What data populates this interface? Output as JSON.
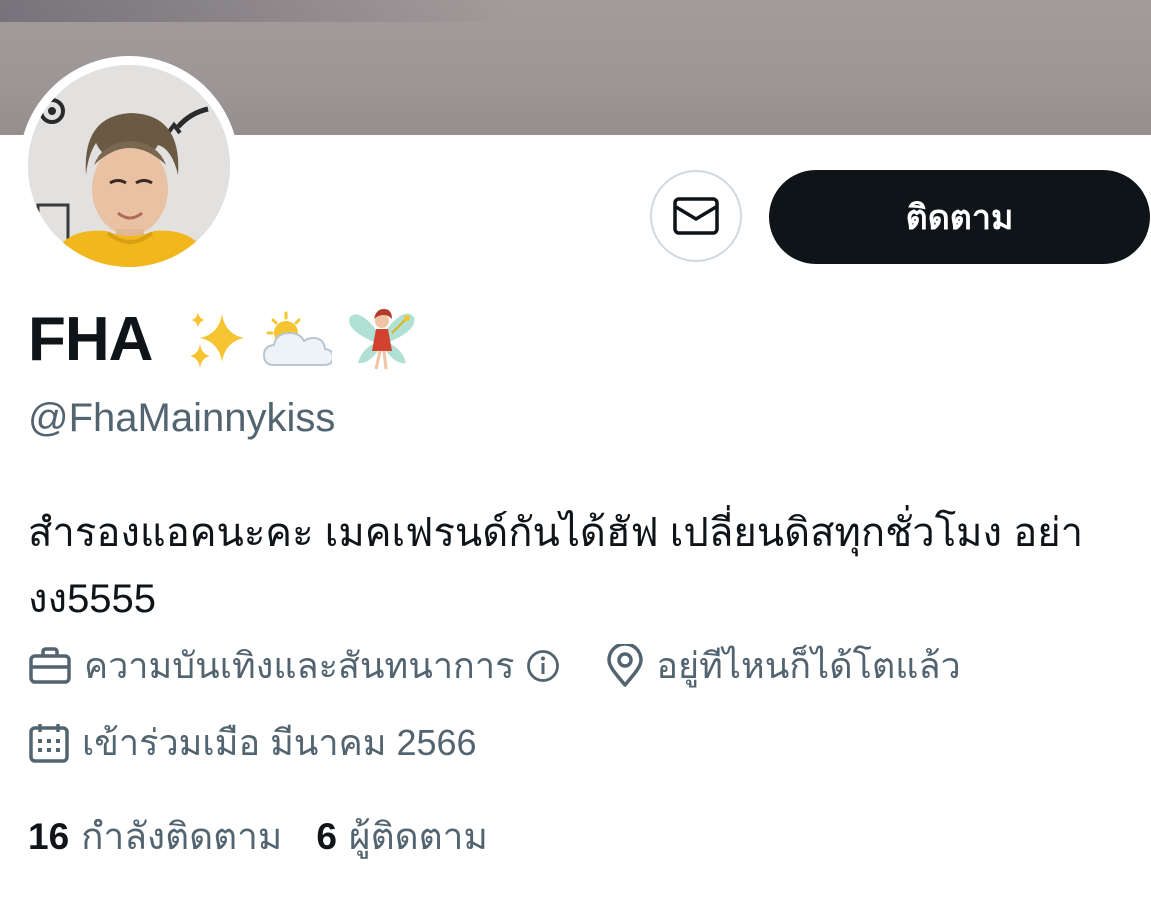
{
  "profile": {
    "display_name": "FHA",
    "name_emojis": [
      "sparkles-emoji",
      "sun-behind-cloud-emoji",
      "fairy-emoji"
    ],
    "handle": "@FhaMainnykiss",
    "bio": "สำรองแอคนะคะ เมคเฟรนด์กันได้ฮัฟ เปลี่ยนดิสทุกชั่วโมง อย่า งง5555",
    "category": "ความบันเทิงและสันทนาการ",
    "location": "อยู่ทีไหนก็ได้โตแล้ว",
    "joined": "เข้าร่วมเมือ มีนาคม 2566"
  },
  "actions": {
    "follow_label": "ติดตาม",
    "message_icon": "envelope-icon"
  },
  "stats": {
    "following_count": "16",
    "following_label": "กำลังติดตาม",
    "followers_count": "6",
    "followers_label": "ผู้ติดตาม"
  },
  "icons": {
    "category": "briefcase-icon",
    "info": "info-icon",
    "location": "location-pin-icon",
    "joined": "calendar-icon"
  },
  "colors": {
    "primary_text": "#0f1419",
    "secondary_text": "#536471",
    "follow_button_bg": "#0f1419",
    "follow_button_text": "#ffffff",
    "border": "#cfd9de"
  }
}
